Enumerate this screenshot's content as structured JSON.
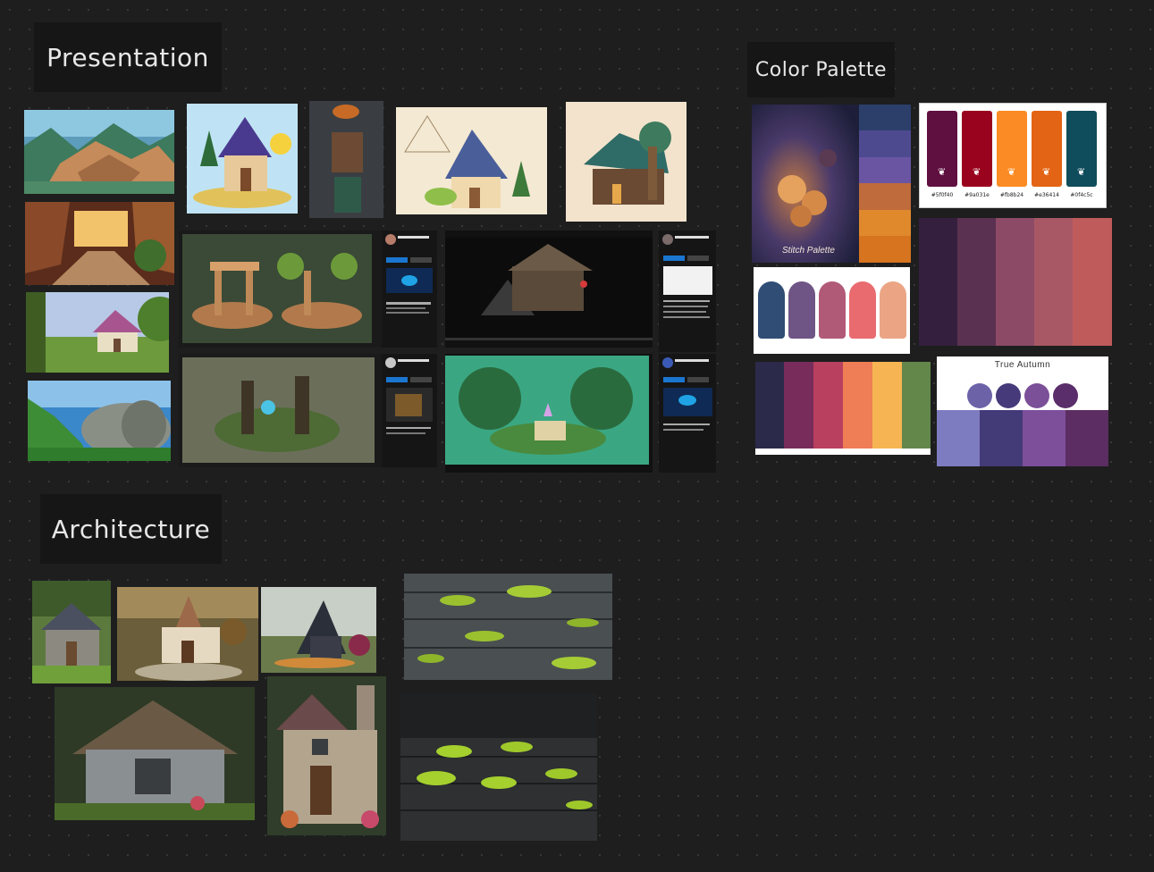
{
  "sections": {
    "presentation": {
      "title": "Presentation"
    },
    "color_palette": {
      "title": "Color Palette"
    },
    "architecture": {
      "title": "Architecture"
    }
  },
  "palettes": {
    "leaf_palette": {
      "hexes": [
        "#5f0f40",
        "#9a031e",
        "#fb8b24",
        "#e36414",
        "#0f4c5c"
      ]
    },
    "true_autumn": {
      "title": "True Autumn",
      "circles": [
        "#6b62a8",
        "#473a7a",
        "#7c4f99",
        "#5a2e6a"
      ],
      "blocks": [
        "#7e7cc0",
        "#433a78",
        "#7d4e9a",
        "#5c2d62"
      ]
    },
    "pastel_pills": [
      "#2f4d75",
      "#6e5585",
      "#b15a77",
      "#e96b70",
      "#eba585"
    ],
    "dark_stripes": [
      "#341f3e",
      "#5a3150",
      "#8c4a66",
      "#a85865",
      "#c05b5c"
    ],
    "sunset_strips": [
      "#2b2a4a",
      "#772c5c",
      "#b9405e",
      "#ef7d55",
      "#f6b552",
      "#63874a"
    ],
    "stitch_palette": {
      "brand": "Stitch Palette",
      "swatches": [
        "#2c3f6b",
        "#4e4a8f",
        "#6a55a2",
        "#c06b3c",
        "#e0892c",
        "#d6741f"
      ]
    }
  },
  "colors": {
    "canvas_bg": "#1e1e1e",
    "label_bg": "#161616",
    "label_text": "#e8e8e8"
  }
}
